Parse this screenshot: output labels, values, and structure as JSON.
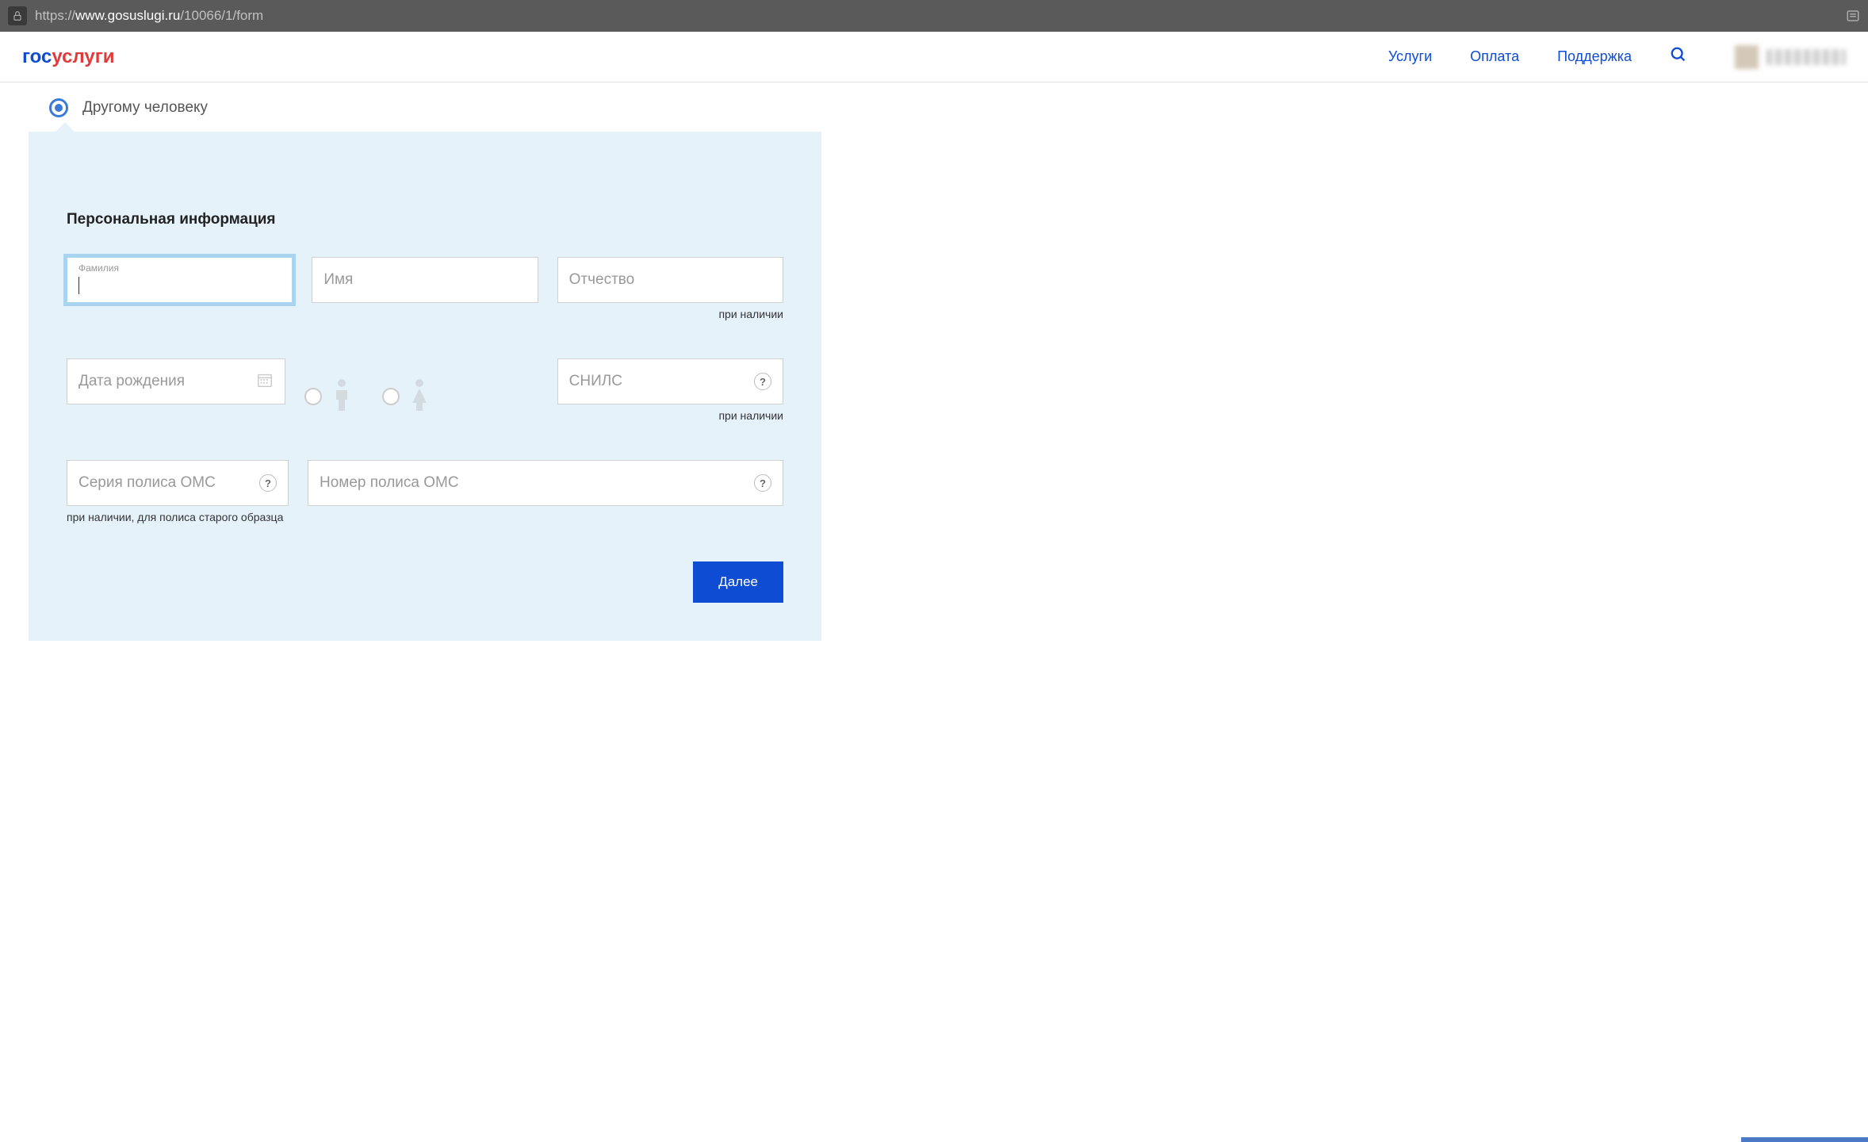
{
  "url": {
    "protocol": "https://",
    "domain": "www.gosuslugi.ru",
    "path": "/10066/1/form"
  },
  "logo": {
    "part1": "гос",
    "part2": "услуги"
  },
  "nav": {
    "services": "Услуги",
    "payment": "Оплата",
    "support": "Поддержка"
  },
  "radio": {
    "other_person": "Другому человеку"
  },
  "section": {
    "title": "Персональная информация"
  },
  "fields": {
    "lastname": {
      "label": "Фамилия"
    },
    "firstname": {
      "placeholder": "Имя"
    },
    "patronymic": {
      "placeholder": "Отчество",
      "hint": "при наличии"
    },
    "birthdate": {
      "placeholder": "Дата рождения"
    },
    "snils": {
      "placeholder": "СНИЛС",
      "hint": "при наличии"
    },
    "oms_series": {
      "placeholder": "Серия полиса ОМС",
      "hint": "при наличии, для полиса старого образца"
    },
    "oms_number": {
      "placeholder": "Номер полиса ОМС"
    }
  },
  "buttons": {
    "next": "Далее"
  }
}
